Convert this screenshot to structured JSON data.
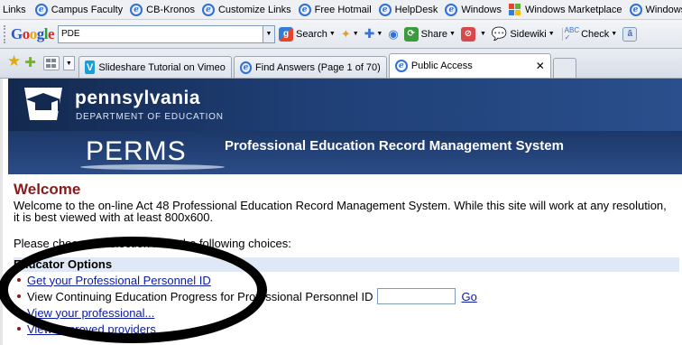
{
  "links_bar": {
    "title": "Links",
    "items": [
      "Campus Faculty",
      "CB-Kronos",
      "Customize Links",
      "Free Hotmail",
      "HelpDesk",
      "Windows",
      "Windows Marketplace",
      "Windows"
    ]
  },
  "google_toolbar": {
    "logo": "Google",
    "search_value": "PDE",
    "search_label": "Search",
    "share_label": "Share",
    "sidewiki_label": "Sidewiki",
    "check_label": "Check",
    "abc_icon_text": "ABC",
    "icons": [
      "search-icon",
      "bookmark-icon",
      "plus-icon",
      "share-icon",
      "sidewiki-icon",
      "spellcheck-icon"
    ]
  },
  "tabs": [
    {
      "label": "Slideshare Tutorial on Vimeo",
      "icon": "vimeo-icon",
      "vimeo_letter": "V"
    },
    {
      "label": "Find Answers (Page 1 of 70)",
      "icon": "ie-icon"
    },
    {
      "label": "Public Access",
      "icon": "ie-icon",
      "active": true
    }
  ],
  "banner": {
    "state_name": "pennsylvania",
    "department": "DEPARTMENT OF EDUCATION",
    "app_short": "PERMS",
    "app_full": "Professional Education Record Management System"
  },
  "content": {
    "welcome_title": "Welcome",
    "welcome_text": "Welcome to the on-line Act 48 Professional Education Record Management System. While this site will work at any resolution, it is best viewed with at least 800x600.",
    "choose_text": "Please choose a selection from the following choices:",
    "options_heading": "Educator Options",
    "option_get_pid": "Get your Professional Personnel ID",
    "option_view_ce": "View Continuing Education Progress for Professional Personnel ID",
    "go_label": "Go",
    "option_hidden": "View your professional...",
    "option_providers": "View approved providers"
  },
  "colors": {
    "banner_blue": "#1d3a6e",
    "welcome_red": "#8b1a1a",
    "link_blue": "#0b1b9e",
    "options_bar": "#dfe8f6"
  }
}
